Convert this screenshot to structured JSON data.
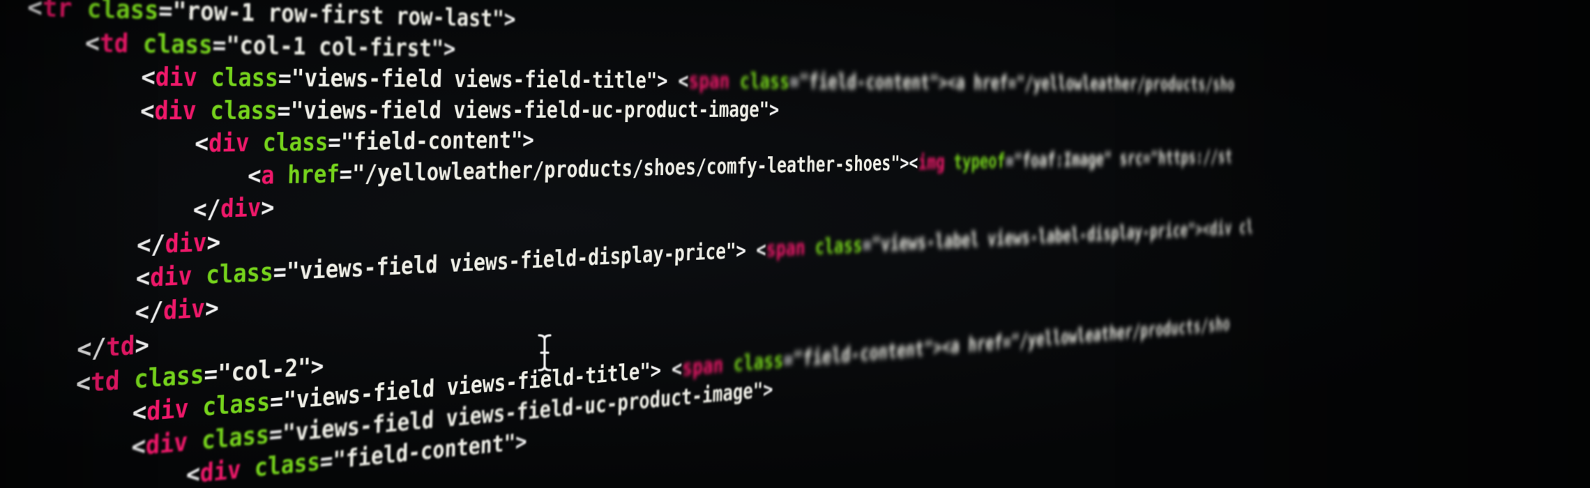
{
  "code_lines": [
    {
      "indent": 0,
      "open": "<",
      "tag": "tr",
      "attr": "class",
      "value": "\"row-1 row-first row-last\"",
      "close": ">"
    },
    {
      "indent": 1,
      "open": "<",
      "tag": "td",
      "attr": "class",
      "value": "\"col-1 col-first\"",
      "close": ">"
    },
    {
      "indent": 2,
      "open": "<",
      "tag": "div",
      "attr": "class",
      "value": "\"views-field views-field-title\"",
      "close": ">",
      "tail_open": " <",
      "tail_tag": "span",
      "tail_attr": "class",
      "tail_value": "\"field-content\"><a href=\"/yellowleather/products/sho"
    },
    {
      "indent": 2,
      "open": "<",
      "tag": "div",
      "attr": "class",
      "value": "\"views-field views-field-uc-product-image\"",
      "close": ">"
    },
    {
      "indent": 3,
      "open": "<",
      "tag": "div",
      "attr": "class",
      "value": "\"field-content\"",
      "close": ">"
    },
    {
      "indent": 4,
      "open": "<",
      "tag": "a",
      "attr": "href",
      "value": "\"/yellowleather/products/shoes/comfy-leather-shoes\"",
      "close": "><",
      "tail_tag": "img",
      "tail_attr": "typeof",
      "tail_value": "\"foaf:Image\" src=\"https://st"
    },
    {
      "indent": 3,
      "open": "</",
      "tag": "div",
      "close": ">"
    },
    {
      "indent": 2,
      "open": "</",
      "tag": "div",
      "close": ">"
    },
    {
      "indent": 2,
      "open": "<",
      "tag": "div",
      "attr": "class",
      "value": "\"views-field views-field-display-price\"",
      "close": ">",
      "tail_open": " <",
      "tail_tag": "span",
      "tail_attr": "class",
      "tail_value": "\"views-label views-label-display-price\"><div cl"
    },
    {
      "indent": 2,
      "open": "</",
      "tag": "div",
      "close": ">"
    },
    {
      "indent": 1,
      "open": "</",
      "tag": "td",
      "close": ">"
    },
    {
      "indent": 1,
      "open": "<",
      "tag": "td",
      "attr": "class",
      "value": "\"col-2\"",
      "close": ">"
    },
    {
      "indent": 2,
      "open": "<",
      "tag": "div",
      "attr": "class",
      "value": "\"views-field views-field-title\"",
      "close": ">",
      "tail_open": " <",
      "tail_tag": "span",
      "tail_attr": "class",
      "tail_value": "\"field-content\"><a href=\"/yellowleather/products/sho"
    },
    {
      "indent": 2,
      "open": "<",
      "tag": "div",
      "attr": "class",
      "value": "\"views-field views-field-uc-product-image\"",
      "close": ">"
    },
    {
      "indent": 3,
      "open": "<",
      "tag": "div",
      "attr": "class",
      "value": "\"field-content\"",
      "close": ">"
    }
  ],
  "colors": {
    "background": "#050607",
    "tag": "#f0186a",
    "attribute": "#76d41c",
    "string": "#f0f0e8",
    "punctuation": "#f2f2f2"
  },
  "cursor_icon": "text-cursor-ibeam-icon"
}
